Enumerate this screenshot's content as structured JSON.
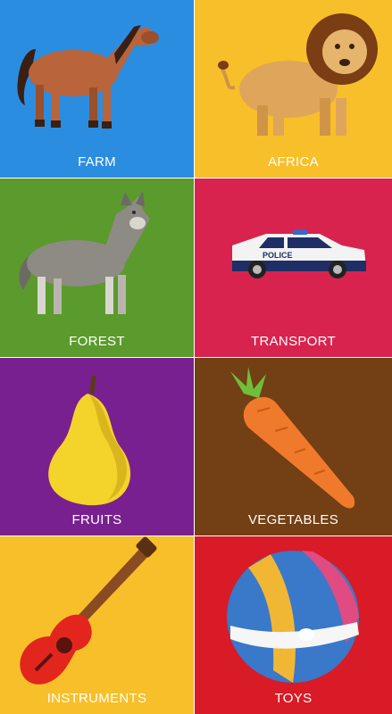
{
  "categories": [
    {
      "label": "FARM",
      "icon": "horse-icon",
      "color": "#2b8de0"
    },
    {
      "label": "AFRICA",
      "icon": "lion-icon",
      "color": "#f7bf2a"
    },
    {
      "label": "FOREST",
      "icon": "wolf-icon",
      "color": "#5b9a2c"
    },
    {
      "label": "TRANSPORT",
      "icon": "police-car-icon",
      "color": "#d8234e"
    },
    {
      "label": "FRUITS",
      "icon": "pear-icon",
      "color": "#78208f"
    },
    {
      "label": "VEGETABLES",
      "icon": "carrot-icon",
      "color": "#733f14"
    },
    {
      "label": "INSTRUMENTS",
      "icon": "guitar-icon",
      "color": "#f7bf2a"
    },
    {
      "label": "TOYS",
      "icon": "ball-icon",
      "color": "#d81b26"
    }
  ],
  "car_text": "POLICE"
}
